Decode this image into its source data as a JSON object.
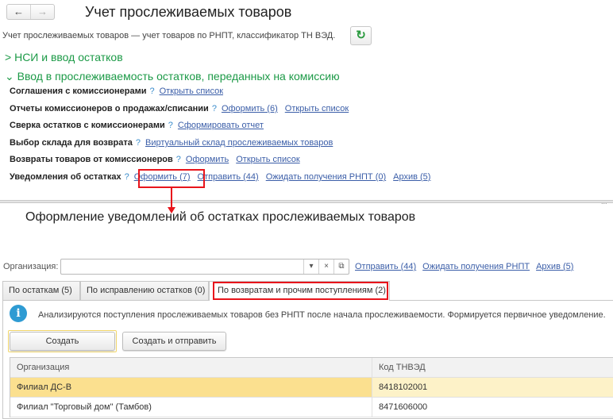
{
  "header": {
    "title": "Учет прослеживаемых товаров",
    "description": "Учет прослеживаемых товаров — учет товаров по РНПТ, классификатор ТН ВЭД.",
    "back_icon": "←",
    "forward_icon": "→",
    "refresh_icon": "↻"
  },
  "groups": [
    {
      "label": "НСИ и ввод остатков",
      "chevron": ">"
    },
    {
      "label": "Ввод в прослеживаемость остатков, переданных на комиссию",
      "chevron": "⌄"
    }
  ],
  "rows": [
    {
      "label": "Соглашения с комиссионерами",
      "help": "?",
      "links": [
        "Открыть список"
      ]
    },
    {
      "label": "Отчеты комиссионеров о продажах/списании",
      "help": "?",
      "links": [
        "Оформить (6)",
        "Открыть список"
      ]
    },
    {
      "label": "Сверка остатков с комиссионерами",
      "help": "?",
      "links": [
        "Сформировать отчет"
      ]
    },
    {
      "label": "Выбор склада для возврата",
      "help": "?",
      "links": [
        "Виртуальный склад прослеживаемых товаров"
      ]
    },
    {
      "label": "Возвраты товаров от комиссионеров",
      "help": "?",
      "links": [
        "Оформить",
        "Открыть список"
      ]
    },
    {
      "label": "Уведомления об остатках",
      "help": "?",
      "links": [
        "Оформить (7)",
        "Отправить (44)",
        "Ожидать получения РНПТ (0)",
        "Архив (5)"
      ]
    }
  ],
  "splitter_dots": "...",
  "form": {
    "title": "Оформление уведомлений об остатках прослеживаемых товаров",
    "org_label": "Организация:",
    "org_value": "",
    "dropdown_icon": "▾",
    "clear_icon": "×",
    "open_icon": "⧉",
    "links": [
      "Отправить (44)",
      "Ожидать получения РНПТ",
      "Архив (5)"
    ],
    "tabs": [
      "По остаткам (5)",
      "По исправлению остатков (0)",
      "По возвратам и прочим поступлениям (2)"
    ],
    "active_tab": 2,
    "info_icon": "i",
    "info_text": "Анализируются поступления прослеживаемых товаров без РНПТ после начала прослеживаемости. Формируется первичное уведомление.",
    "buttons": {
      "create": "Создать",
      "create_send": "Создать и отправить"
    },
    "table": {
      "columns": [
        "Организация",
        "Код ТНВЭД"
      ],
      "rows": [
        [
          "Филиал ДС-В",
          "8418102001"
        ],
        [
          "Филиал \"Торговый дом\" (Тамбов)",
          "8471606000"
        ]
      ]
    }
  },
  "colors": {
    "green": "#1c9a47",
    "link": "#3b5ea8",
    "highlight": "#e8141b",
    "selected_row": "#fbe08f"
  }
}
